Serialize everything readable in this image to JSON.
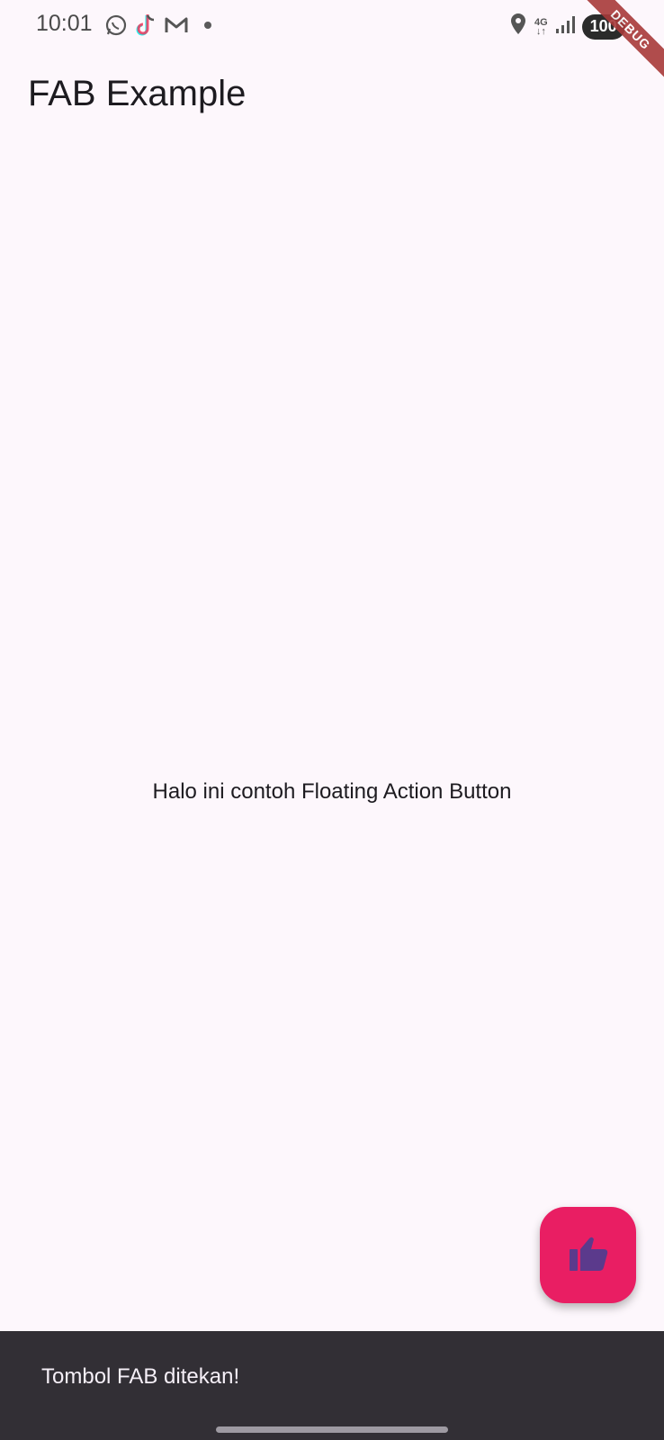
{
  "status_bar": {
    "time": "10:01",
    "notification_icons": [
      "whatsapp-icon",
      "tiktok-icon",
      "gmail-icon",
      "dot-icon"
    ],
    "network_label": "4G",
    "battery_level": "100"
  },
  "debug_banner": "DEBUG",
  "app_bar": {
    "title": "FAB Example"
  },
  "main": {
    "text": "Halo ini contoh Floating Action Button"
  },
  "fab": {
    "icon": "thumb-up-icon",
    "color": "#e91e63",
    "icon_color": "#5b3a8c"
  },
  "snackbar": {
    "message": "Tombol FAB ditekan!"
  }
}
